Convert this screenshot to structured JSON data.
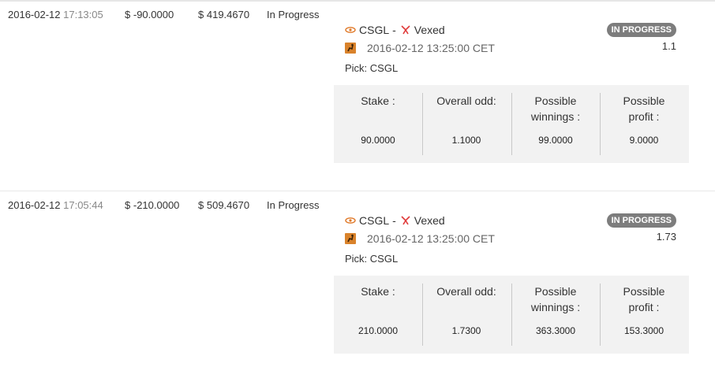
{
  "currency_symbol": "$",
  "bets": [
    {
      "date": "2016-02-12",
      "time": "17:13:05",
      "amount": "-90.0000",
      "balance": "419.4670",
      "status": "In Progress",
      "team1": "CSGL",
      "separator": "-",
      "team2": "Vexed",
      "start_time": "2016-02-12 13:25:00 CET",
      "pick": "Pick: CSGL",
      "badge": "IN PROGRESS",
      "odd": "1.1",
      "stats": [
        {
          "label": "Stake :",
          "value": "90.0000"
        },
        {
          "label": "Overall odd:",
          "value": "1.1000"
        },
        {
          "label": "Possible winnings :",
          "value": "99.0000"
        },
        {
          "label": "Possible profit :",
          "value": "9.0000"
        }
      ]
    },
    {
      "date": "2016-02-12",
      "time": "17:05:44",
      "amount": "-210.0000",
      "balance": "509.4670",
      "status": "In Progress",
      "team1": "CSGL",
      "separator": "-",
      "team2": "Vexed",
      "start_time": "2016-02-12 13:25:00 CET",
      "pick": "Pick: CSGL",
      "badge": "IN PROGRESS",
      "odd": "1.73",
      "stats": [
        {
          "label": "Stake :",
          "value": "210.0000"
        },
        {
          "label": "Overall odd:",
          "value": "1.7300"
        },
        {
          "label": "Possible winnings :",
          "value": "363.3000"
        },
        {
          "label": "Possible profit :",
          "value": "153.3000"
        }
      ]
    }
  ],
  "icons": {
    "team1_logo": "csgl-logo-icon",
    "team2_logo": "vexed-logo-icon",
    "game": "counter-strike-game-icon"
  },
  "colors": {
    "badge_bg": "#7d7d7d",
    "stats_bg": "#f2f2f2",
    "team2_logo": "#e03a3a",
    "team1_logo": "#e07a2a",
    "game_icon": "#d9822b"
  }
}
